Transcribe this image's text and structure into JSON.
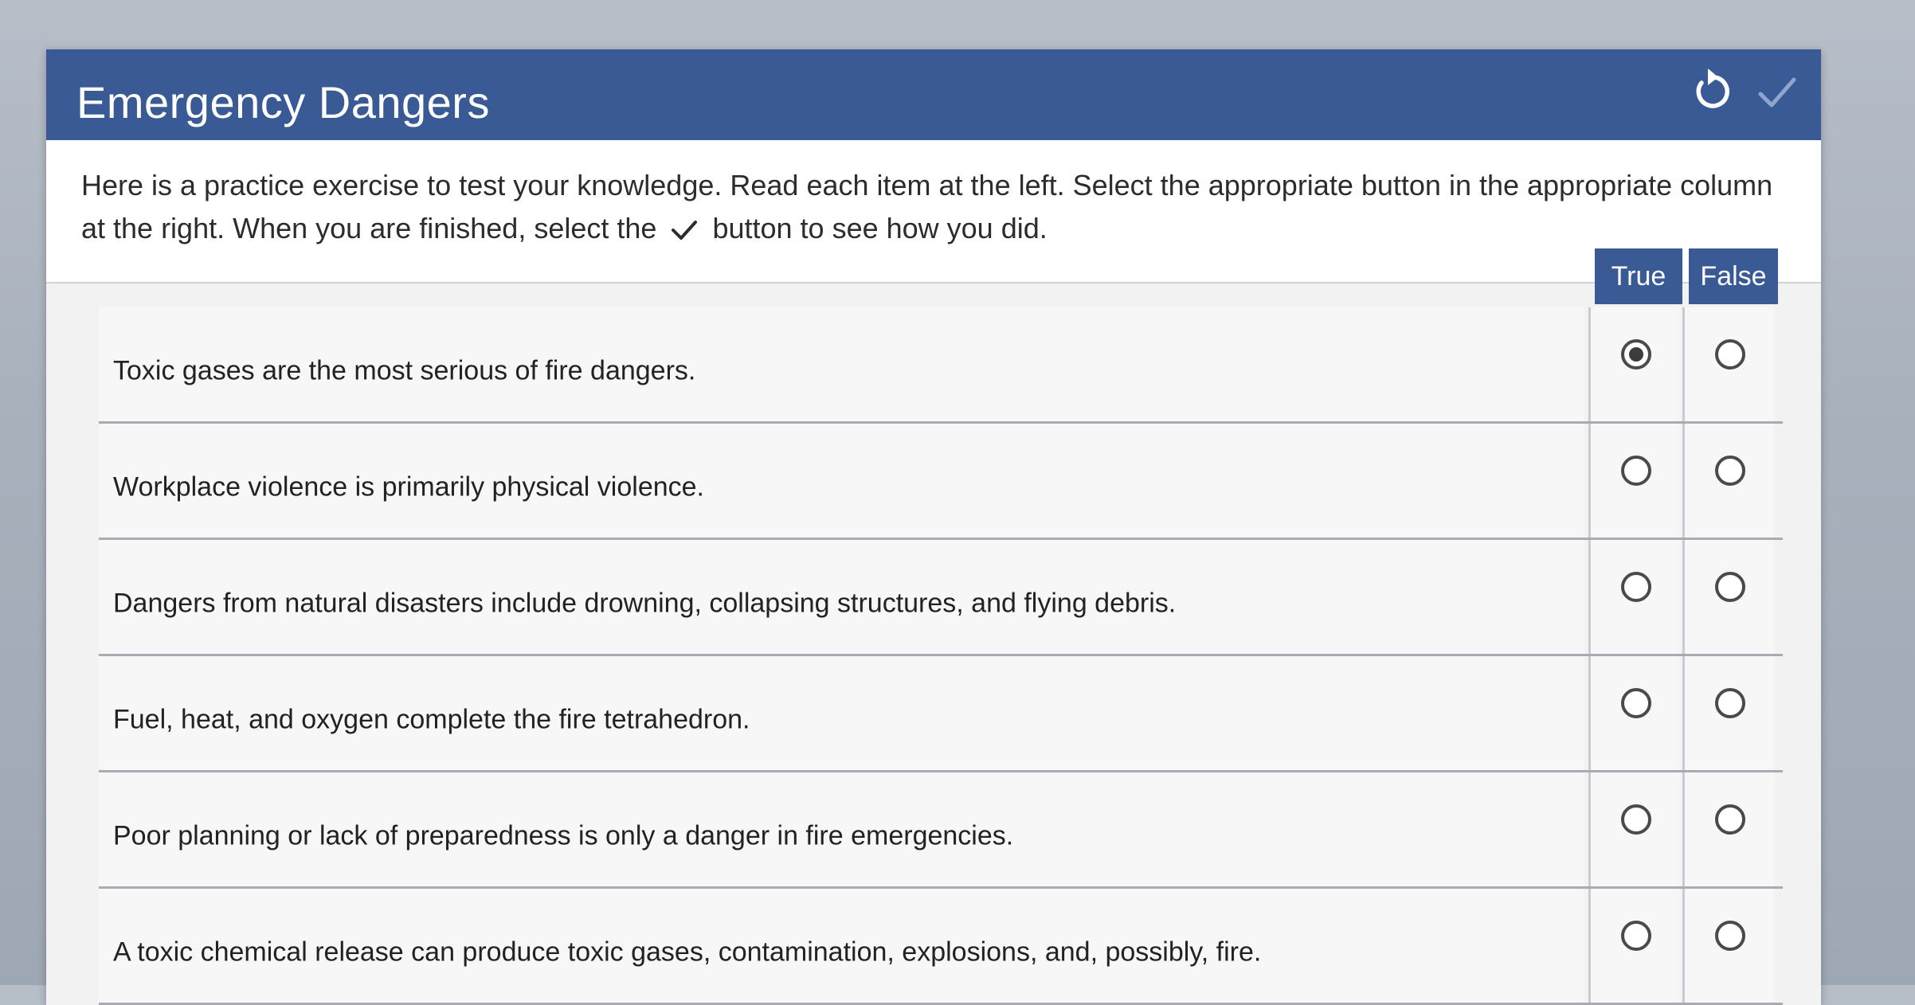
{
  "exercise": {
    "title": "Emergency Dangers",
    "reset_icon": "reset-icon",
    "check_icon": "check-icon",
    "instructions_before": "Here is a practice exercise to test your knowledge. Read each item at the left. Select the appropriate button in the appropriate column at the right. When you are finished, select the",
    "instructions_after": "button to see how you did.",
    "columns": {
      "true_label": "True",
      "false_label": "False"
    },
    "items": [
      {
        "statement": "Toxic gases are the most serious of fire dangers.",
        "selected": "true"
      },
      {
        "statement": "Workplace violence is primarily physical violence.",
        "selected": "none"
      },
      {
        "statement": "Dangers from natural disasters include drowning, collapsing structures, and flying debris.",
        "selected": "none"
      },
      {
        "statement": "Fuel, heat, and oxygen complete the fire tetrahedron.",
        "selected": "none"
      },
      {
        "statement": "Poor planning or lack of preparedness is only a danger in fire emergencies.",
        "selected": "none"
      },
      {
        "statement": "A toxic chemical release can produce toxic gases, contamination, explosions, and, possibly, fire.",
        "selected": "none"
      }
    ]
  },
  "colors": {
    "header_blue": "#395a94",
    "panel_background": "#f2f2f2",
    "check_inactive": "#8fa6cc"
  }
}
